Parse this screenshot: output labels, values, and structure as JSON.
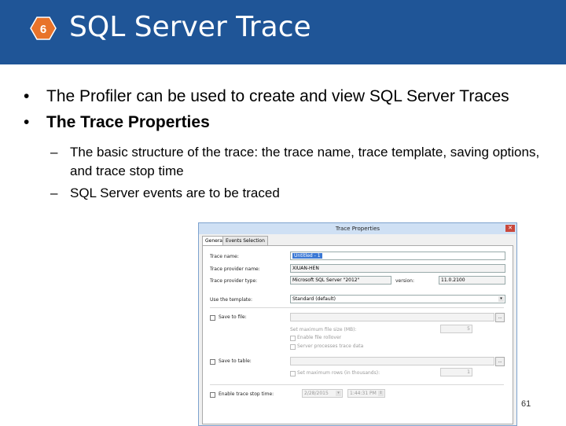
{
  "slide": {
    "number_badge": "6",
    "title": "SQL Server Trace",
    "page_number": "61",
    "bullets": [
      {
        "marker": "•",
        "text": "The Profiler can be used to create and view SQL Server Traces"
      },
      {
        "marker": "•",
        "text": "The Trace Properties"
      }
    ],
    "sub_bullets": [
      {
        "marker": "–",
        "text": "The basic structure of the trace: the trace name, trace template, saving options, and trace stop time"
      },
      {
        "marker": "–",
        "text": "SQL Server events are to be traced"
      }
    ],
    "colors": {
      "header": "#1f5597",
      "badge": "#e8732a"
    }
  },
  "dialog": {
    "title": "Trace Properties",
    "close_label": "✕",
    "tabs": [
      "General",
      "Events Selection"
    ],
    "trace_name_label": "Trace name:",
    "trace_name_value": "Untitled - 1",
    "provider_name_label": "Trace provider name:",
    "provider_name_value": "XIUAN-HEN",
    "provider_type_label": "Trace provider type:",
    "provider_type_value": "Microsoft SQL Server \"2012\"",
    "version_label": "version:",
    "version_value": "11.0.2100",
    "template_label": "Use the template:",
    "template_value": "Standard (default)",
    "save_to_file_label": "Save to file:",
    "max_file_size_label": "Set maximum file size (MB):",
    "max_file_size_value": "5",
    "enable_rollover_label": "Enable file rollover",
    "server_processes_label": "Server processes trace data",
    "save_to_table_label": "Save to table:",
    "max_rows_label": "Set maximum rows (in thousands):",
    "max_rows_value": "1",
    "stop_time_label": "Enable trace stop time:",
    "stop_date_value": "2/28/2015",
    "stop_time_value": "1:44:31 PM",
    "browse_label": "..."
  }
}
